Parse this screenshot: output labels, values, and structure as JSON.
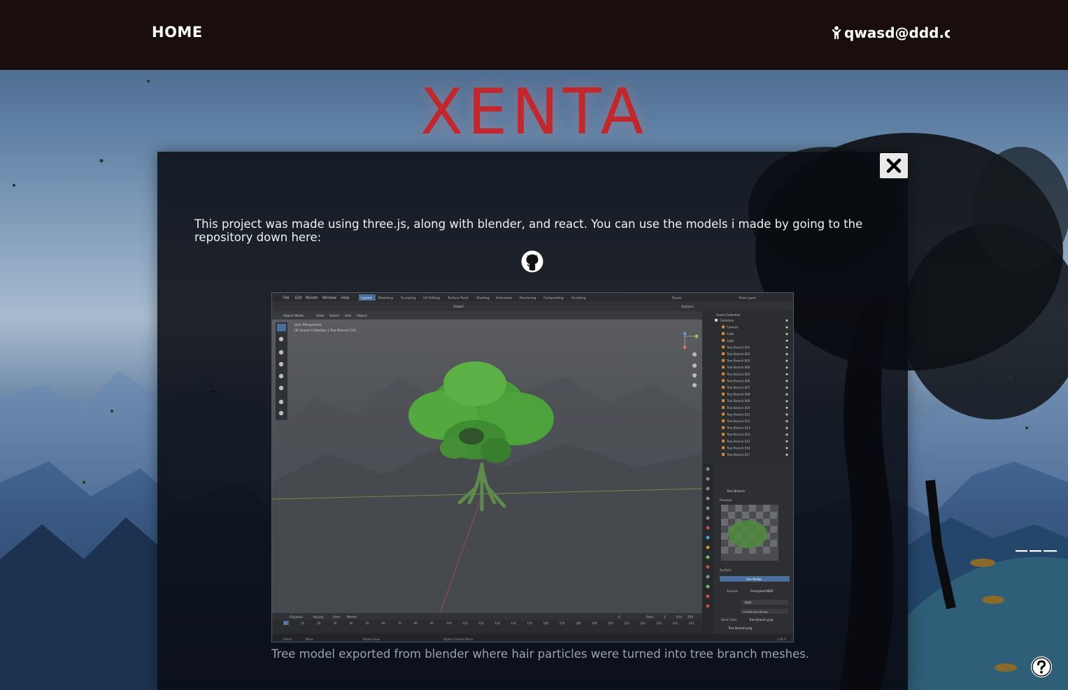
{
  "navbar": {
    "home_label": "HOME",
    "user_email": "qwasd@ddd.com",
    "user_icon": "person-icon"
  },
  "site": {
    "title": "XENTA"
  },
  "modal": {
    "description": "This project was made using three.js, along with blender, and react. You can use the models i made by going to the repository down here:",
    "repo_icon": "github-icon",
    "close_icon": "close-icon",
    "image_caption": "Tree model exported from blender where hair particles were turned into tree branch meshes."
  },
  "blender": {
    "menu": [
      "File",
      "Edit",
      "Render",
      "Window",
      "Help"
    ],
    "workspaces": [
      "Layout",
      "Modeling",
      "Sculpting",
      "UV Editing",
      "Texture Paint",
      "Shading",
      "Animation",
      "Rendering",
      "Compositing",
      "Scripting"
    ],
    "scene_label": "Scene",
    "view_layer_label": "View Layer",
    "viewport_mode": "Object Mode",
    "viewport_menu": [
      "View",
      "Select",
      "Add",
      "Object"
    ],
    "transform_orientation": "Global",
    "options_label": "Options",
    "viewport_info": [
      "User Perspective",
      "(0) Scene Collection | Tree Branch.114"
    ],
    "outliner_header": "Scene Collection",
    "outliner_items": [
      "Collection",
      "Camera",
      "Cube",
      "Light",
      "Tree Branch.001",
      "Tree Branch.002",
      "Tree Branch.003",
      "Tree Branch.004",
      "Tree Branch.005",
      "Tree Branch.006",
      "Tree Branch.007",
      "Tree Branch.008",
      "Tree Branch.009",
      "Tree Branch.010",
      "Tree Branch.011",
      "Tree Branch.012",
      "Tree Branch.013",
      "Tree Branch.014",
      "Tree Branch.015",
      "Tree Branch.016",
      "Tree Branch.017"
    ],
    "material_name": "Tree Branch",
    "preview_label": "Preview",
    "surface_label": "Surface",
    "use_nodes_label": "Use Nodes",
    "surface_value": "Principled BSDF",
    "ggx_label": "GGX",
    "subsurface_method": "Christensen-Burley",
    "base_color_label": "Base Color",
    "base_color_value": "Tree Branch.png",
    "texture_name": "Tree Branch.png",
    "timeline_menu": [
      "Playback",
      "Keying",
      "View",
      "Marker"
    ],
    "current_frame": "0",
    "start_label": "Start",
    "start_value": "1",
    "end_label": "End",
    "end_value": "250",
    "frame_ticks": [
      "0",
      "10",
      "20",
      "30",
      "40",
      "50",
      "60",
      "70",
      "80",
      "90",
      "100",
      "110",
      "120",
      "130",
      "140",
      "150",
      "160",
      "170",
      "180",
      "190",
      "200",
      "210",
      "220",
      "230",
      "240",
      "250"
    ],
    "status_items": [
      "Select",
      "Move",
      "Rotate View",
      "Object Context Menu"
    ],
    "version": "2.91.0"
  },
  "colors": {
    "navbar_bg": "#1a0e0d",
    "title_red": "#c0282d",
    "modal_bg": "#080a10",
    "foliage_green": "#4caf3c",
    "blender_bg": "#3a3d42"
  }
}
